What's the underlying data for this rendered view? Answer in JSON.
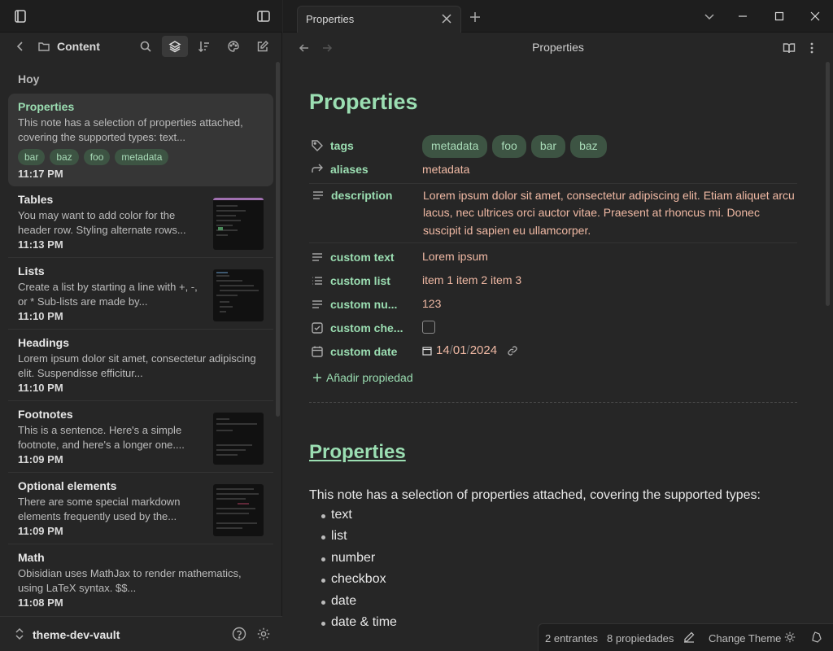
{
  "sidebar": {
    "nav_title": "Content",
    "group_title": "Hoy",
    "notes": [
      {
        "title": "Properties",
        "snippet": "This note has a selection of properties attached, covering the supported types: text...",
        "time": "11:17 PM",
        "tags": [
          "bar",
          "baz",
          "foo",
          "metadata"
        ]
      },
      {
        "title": "Tables",
        "snippet": "You may want to add color for the header row. Styling alternate rows...",
        "time": "11:13 PM"
      },
      {
        "title": "Lists",
        "snippet": "Create a list by starting a line with +, -, or * Sub-lists are made by...",
        "time": "11:10 PM"
      },
      {
        "title": "Headings",
        "snippet": "Lorem ipsum dolor sit amet, consectetur adipiscing elit. Suspendisse efficitur...",
        "time": "11:10 PM"
      },
      {
        "title": "Footnotes",
        "snippet": "This is a sentence. Here's a simple footnote, and here's a longer one....",
        "time": "11:09 PM"
      },
      {
        "title": "Optional elements",
        "snippet": "There are some special markdown elements frequently used by the...",
        "time": "11:09 PM"
      },
      {
        "title": "Math",
        "snippet": "Obisidian uses MathJax to render mathematics, using LaTeX syntax. $$...",
        "time": "11:08 PM"
      }
    ],
    "vault_name": "theme-dev-vault"
  },
  "tab": {
    "title": "Properties"
  },
  "view": {
    "title": "Properties",
    "inline_title": "Properties",
    "properties": {
      "tags": {
        "key": "tags",
        "values": [
          "metadata",
          "foo",
          "bar",
          "baz"
        ]
      },
      "aliases": {
        "key": "aliases",
        "value": "metadata"
      },
      "description": {
        "key": "description",
        "value": "Lorem ipsum dolor sit amet, consectetur adipiscing elit. Etiam aliquet arcu lacus, nec ultrices orci auctor vitae. Praesent at rhoncus mi. Donec suscipit id sapien eu ullamcorper."
      },
      "custom_text": {
        "key": "custom text",
        "value": "Lorem ipsum"
      },
      "custom_list": {
        "key": "custom list",
        "values": [
          "item 1",
          "item 2",
          "item 3"
        ]
      },
      "custom_number": {
        "key": "custom nu...",
        "value": "123"
      },
      "custom_checkbox": {
        "key": "custom che...",
        "checked": false
      },
      "custom_date": {
        "key": "custom date",
        "day": "14",
        "month": "01",
        "year": "2024",
        "sep": "/"
      }
    },
    "add_property": "Añadir propiedad",
    "heading": "Properties",
    "paragraph": "This note has a selection of properties attached, covering the supported types:",
    "bullets": [
      "text",
      "list",
      "number",
      "checkbox",
      "date",
      "date & time"
    ]
  },
  "statusbar": {
    "backlinks": "2 entrantes",
    "props": "8 propiedades",
    "theme": "Change Theme"
  },
  "colors": {
    "accent": "#9bdeb2",
    "value": "#f0b9a4",
    "tag_bg": "#3d5443"
  }
}
